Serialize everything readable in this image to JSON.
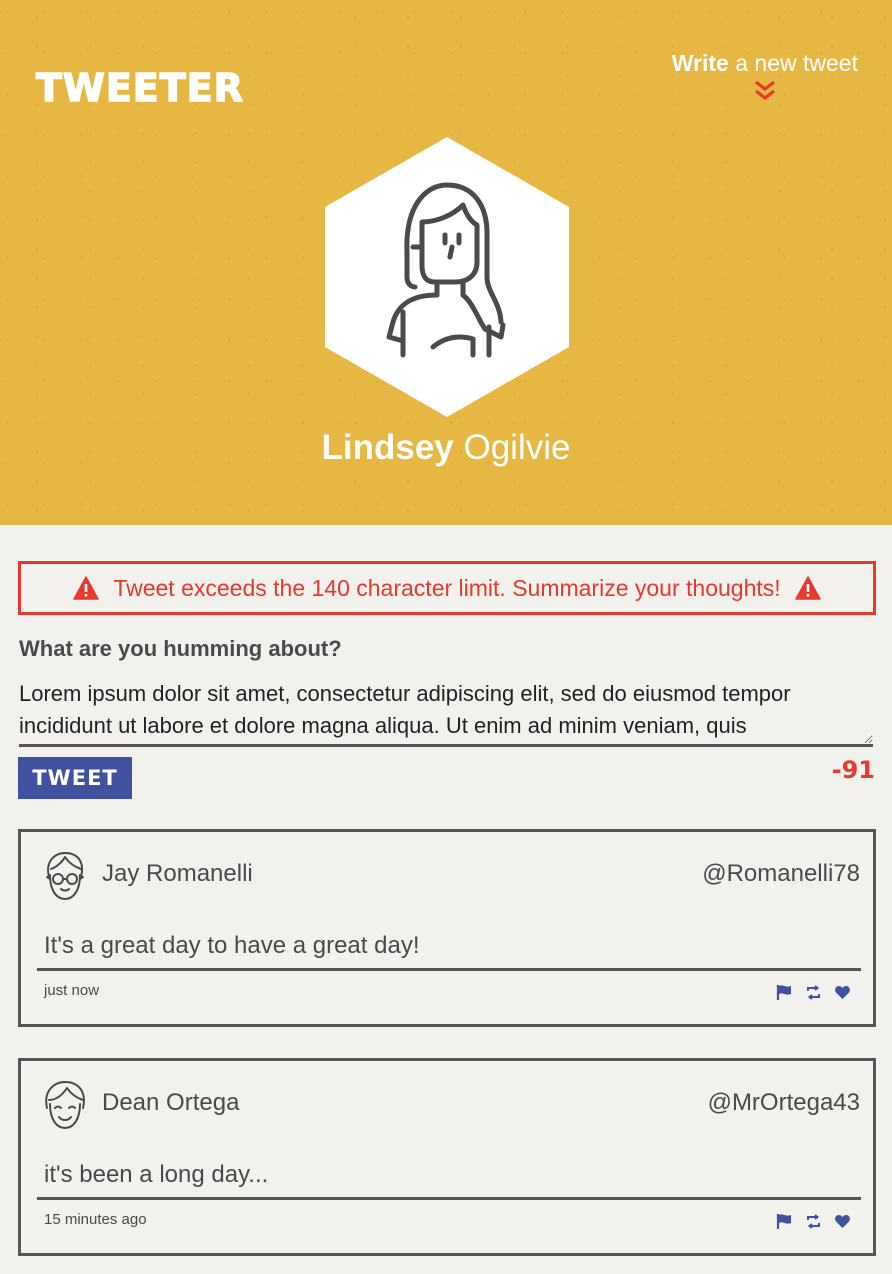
{
  "header": {
    "logo": "TWEETER",
    "compose_link": {
      "bold": "Write",
      "rest": " a new tweet"
    },
    "profile": {
      "first_name": "Lindsey",
      "last_name": " Ogilvie"
    }
  },
  "error": {
    "message": "Tweet exceeds the 140 character limit. Summarize your thoughts!"
  },
  "compose": {
    "label": "What are you humming about?",
    "value": "Lorem ipsum dolor sit amet, consectetur adipiscing elit, sed do eiusmod tempor incididunt ut labore et dolore magna aliqua. Ut enim ad minim veniam, quis",
    "button_label": "TWEET",
    "counter": "-91"
  },
  "tweets": [
    {
      "name": "Jay Romanelli",
      "handle": "@Romanelli78",
      "content": "It's a great day to have a great day!",
      "time": "just now"
    },
    {
      "name": "Dean Ortega",
      "handle": "@MrOrtega43",
      "content": "it's been a long day...",
      "time": "15 minutes ago"
    }
  ],
  "colors": {
    "header_bg": "#e6b843",
    "accent_blue": "#4051a0",
    "error_red": "#e8392f"
  },
  "icons": [
    "chevron-double-down-icon",
    "warning-icon",
    "flag-icon",
    "retweet-icon",
    "heart-icon",
    "user-avatar-icon"
  ]
}
